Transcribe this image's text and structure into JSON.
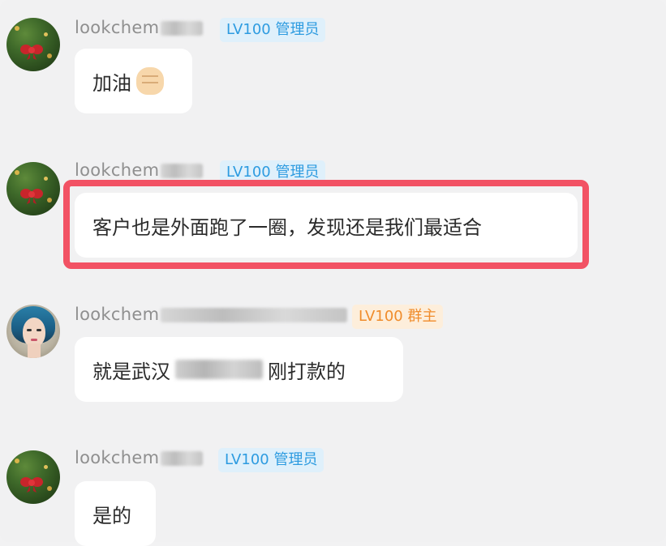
{
  "messages": [
    {
      "sender": "lookchem",
      "badge": "LV100 管理员",
      "text": "加油",
      "emoji": "fist-icon"
    },
    {
      "sender": "lookchem",
      "badge": "LV100 管理员",
      "text": "客户也是外面跑了一圈，发现还是我们最适合"
    },
    {
      "sender": "lookchem",
      "badge": "LV100 群主",
      "text_before": "就是武汉",
      "text_after": "刚打款的"
    },
    {
      "sender": "lookchem",
      "badge": "LV100 管理员",
      "text": "是的"
    }
  ],
  "colors": {
    "admin_badge_bg": "#dff0fb",
    "admin_badge_text": "#2d9be0",
    "owner_badge_bg": "#fdeedb",
    "owner_badge_text": "#f08c2b",
    "highlight_border": "#f25264"
  }
}
